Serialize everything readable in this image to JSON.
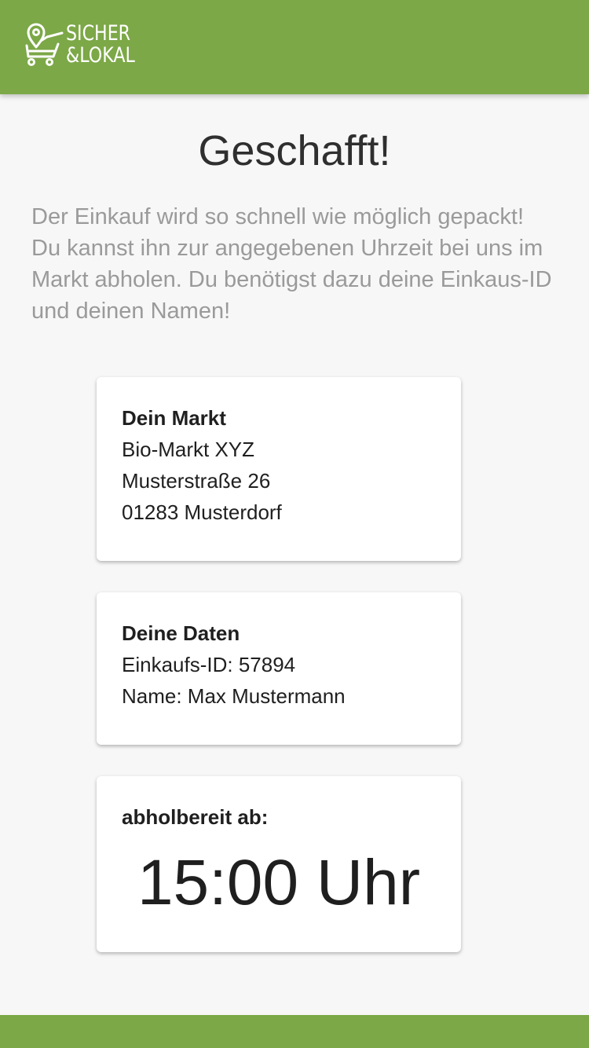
{
  "header": {
    "logo_line1": "SICHER",
    "logo_line2": "&LOKAL",
    "brand_color": "#7ca847",
    "logo_icon": "location-cart-icon"
  },
  "main": {
    "title": "Geschafft!",
    "intro_line1": "Der Einkauf wird so schnell wie möglich gepackt!",
    "intro_line2": "Du kannst ihn zur angegebenen Uhrzeit bei uns im Markt abholen. Du benötigst dazu deine Einkaus-ID und deinen Namen!"
  },
  "market_card": {
    "heading": "Dein Markt",
    "name": "Bio-Markt XYZ",
    "street": "Musterstraße 26",
    "city": "01283 Musterdorf"
  },
  "data_card": {
    "heading": "Deine Daten",
    "order_id": "Einkaufs-ID: 57894",
    "customer_name": "Name: Max Mustermann"
  },
  "pickup_card": {
    "heading": "abholbereit ab:",
    "time": "15:00 Uhr"
  }
}
